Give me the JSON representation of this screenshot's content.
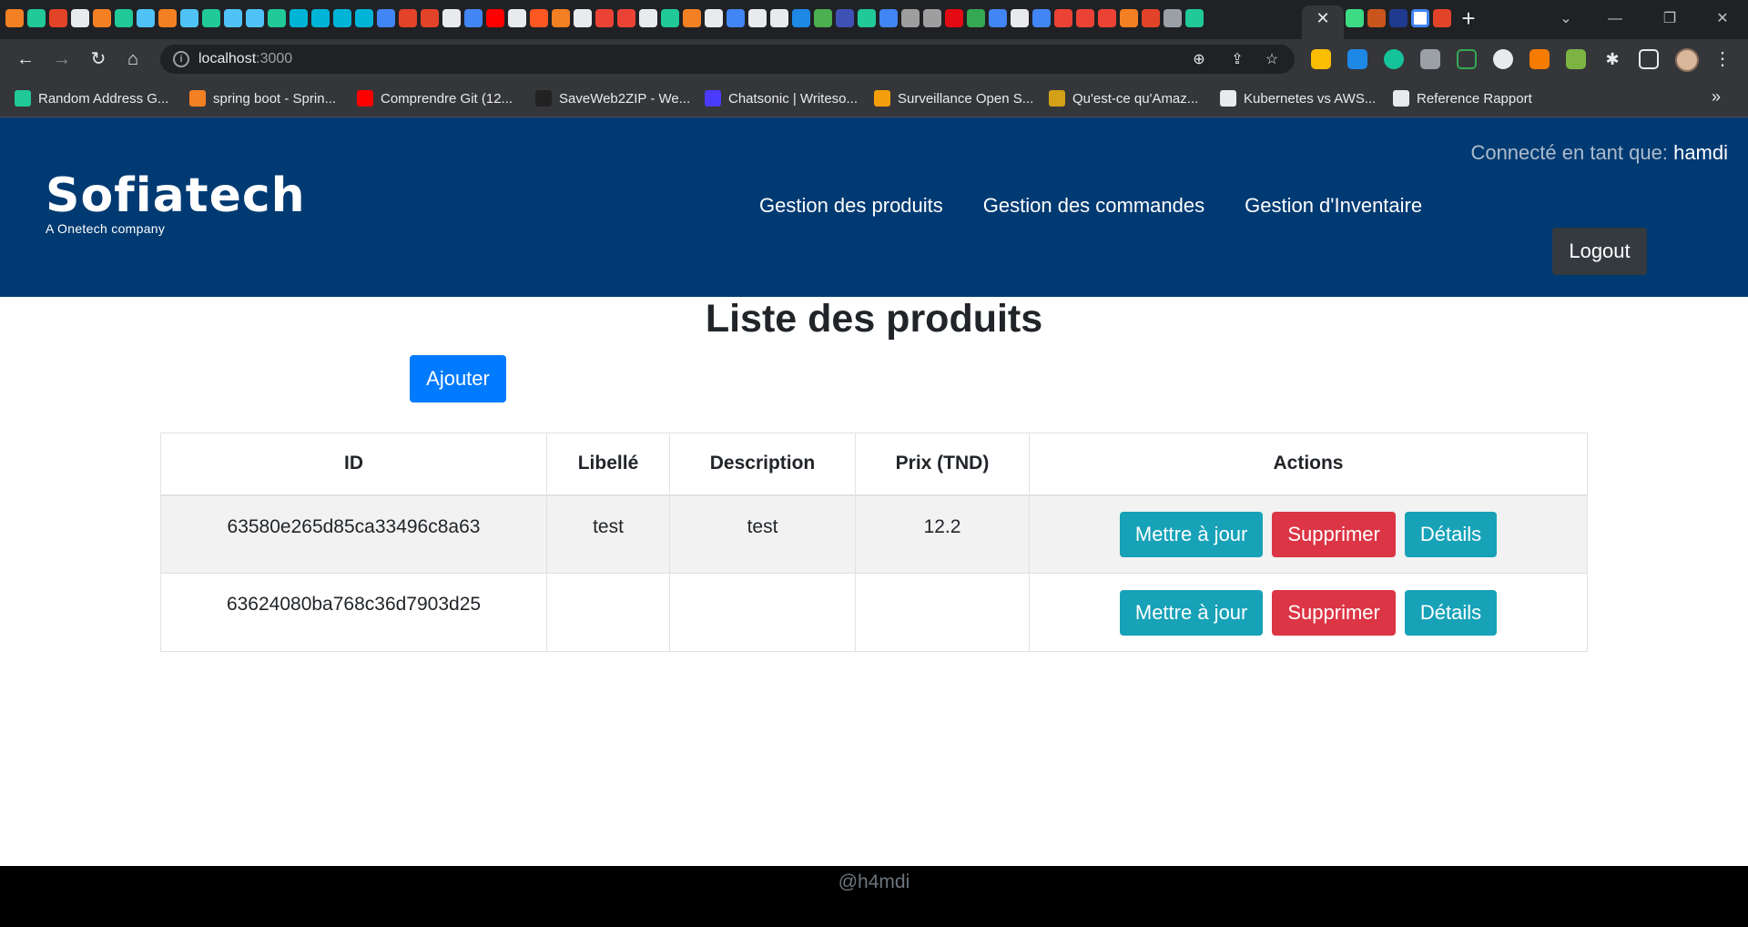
{
  "browser": {
    "url_host": "localhost",
    "url_port": ":3000",
    "bookmarks": [
      {
        "label": "Random Address G...",
        "color": "#20c997"
      },
      {
        "label": "spring boot - Sprin...",
        "color": "#f48024"
      },
      {
        "label": "Comprendre Git (12...",
        "color": "#ff0000"
      },
      {
        "label": "SaveWeb2ZIP - We...",
        "color": "#222222"
      },
      {
        "label": "Chatsonic | Writeso...",
        "color": "#4b3bff"
      },
      {
        "label": "Surveillance Open S...",
        "color": "#f59e0b"
      },
      {
        "label": "Qu'est-ce qu'Amaz...",
        "color": "#d4a017"
      },
      {
        "label": "Kubernetes vs AWS...",
        "color": "#e8eaed"
      },
      {
        "label": "Reference Rapport",
        "color": "#e8eaed"
      }
    ]
  },
  "header": {
    "logo_text": "Sofiatech",
    "logo_tagline": "A Onetech company",
    "connected_label": "Connecté en tant que: ",
    "username": "hamdi",
    "nav": [
      "Gestion des produits",
      "Gestion des commandes",
      "Gestion d'Inventaire"
    ],
    "logout_label": "Logout"
  },
  "main": {
    "title": "Liste des produits",
    "add_label": "Ajouter",
    "table": {
      "headers": [
        "ID",
        "Libellé",
        "Description",
        "Prix (TND)",
        "Actions"
      ],
      "rows": [
        {
          "id": "63580e265d85ca33496c8a63",
          "libelle": "test",
          "description": "test",
          "prix": "12.2"
        },
        {
          "id": "63624080ba768c36d7903d25",
          "libelle": "",
          "description": "",
          "prix": ""
        }
      ],
      "actions": {
        "update": "Mettre à jour",
        "delete": "Supprimer",
        "details": "Détails"
      }
    }
  },
  "footer": {
    "text": "@h4mdi"
  },
  "colors": {
    "header_bg": "#003a72",
    "primary": "#007bff",
    "info": "#17a2b8",
    "danger": "#dc3545",
    "dark": "#343a40"
  }
}
